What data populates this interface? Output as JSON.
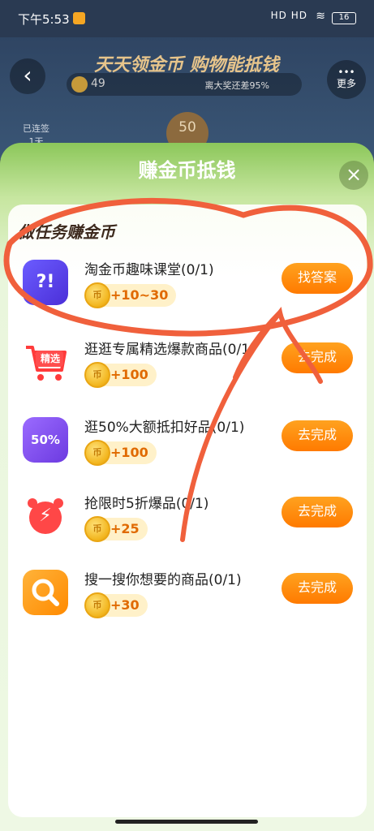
{
  "status_bar": {
    "time": "下午5:53",
    "signal": "HD HD",
    "battery": "16"
  },
  "header": {
    "back_icon": "chevron-left-icon",
    "title": "天天领金币 购物能抵钱",
    "coin_count": "49",
    "prize_text": "离大奖还差95%",
    "more_label": "更多",
    "streak_label": "已连签\n1天",
    "streak_number": "50"
  },
  "sheet": {
    "title": "赚金币抵钱",
    "close_icon": "close-icon",
    "section_title": "做任务赚金币"
  },
  "tasks": [
    {
      "icon": "quiz-icon",
      "icon_text": "?!",
      "name": "淘金币趣味课堂(0/1)",
      "reward": "+10~30",
      "button": "找答案"
    },
    {
      "icon": "cart-icon",
      "icon_text": "精选",
      "name": "逛逛专属精选爆款商品(0/1)",
      "reward": "+100",
      "button": "去完成"
    },
    {
      "icon": "discount-bag-icon",
      "icon_text": "50%",
      "name": "逛50%大额抵扣好品(0/1)",
      "reward": "+100",
      "button": "去完成"
    },
    {
      "icon": "alarm-clock-icon",
      "icon_text": "⚡",
      "name": "抢限时5折爆品(0/1)",
      "reward": "+25",
      "button": "去完成"
    },
    {
      "icon": "search-icon",
      "icon_text": "",
      "name": "搜一搜你想要的商品(0/1)",
      "reward": "+30",
      "button": "去完成"
    }
  ],
  "coin_glyph": "币",
  "colors": {
    "accent_orange": "#ff8a00",
    "reward_orange": "#e06a00",
    "annotation_red": "#f0603c"
  }
}
